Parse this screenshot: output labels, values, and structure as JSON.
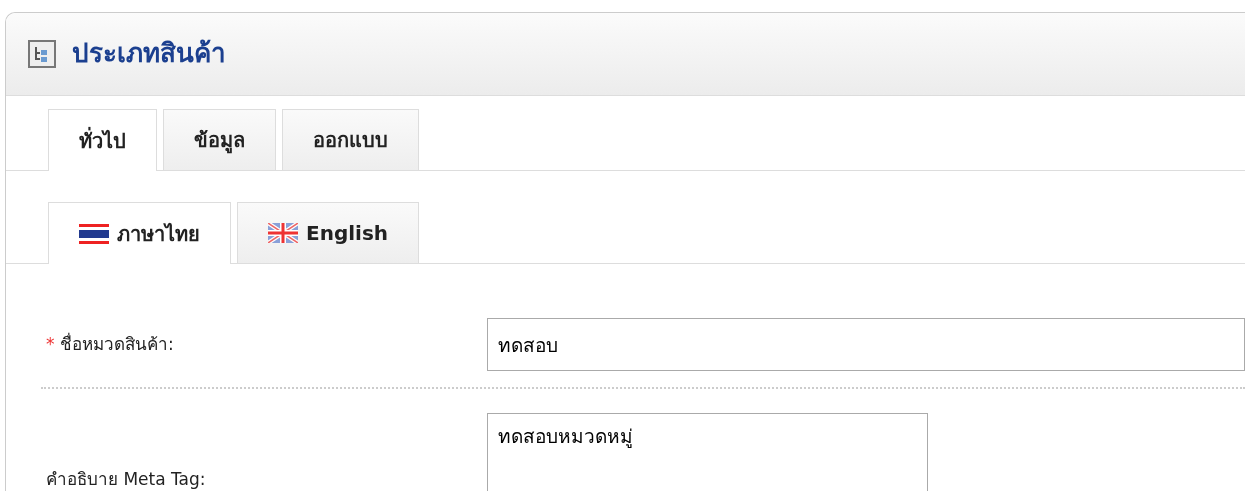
{
  "panel": {
    "title": "ประเภทสินค้า"
  },
  "tabs": [
    {
      "label": "ทั่วไป",
      "selected": true
    },
    {
      "label": "ข้อมูล",
      "selected": false
    },
    {
      "label": "ออกแบบ",
      "selected": false
    }
  ],
  "language_tabs": [
    {
      "label": "ภาษาไทย",
      "kind": "thai",
      "selected": true
    },
    {
      "label": "English",
      "kind": "english",
      "selected": false
    }
  ],
  "fields": [
    {
      "label": "ชื่อหมวดสินค้า:",
      "required_mark": "*",
      "kind": "input",
      "value": "ทดสอบ"
    },
    {
      "label": "คำอธิบาย Meta Tag:",
      "kind": "textarea",
      "value": "ทดสอบหมวดหมู่"
    }
  ]
}
